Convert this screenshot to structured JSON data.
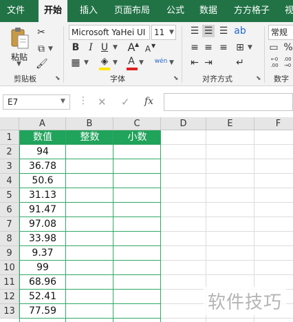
{
  "menu": {
    "tabs": [
      "文件",
      "开始",
      "插入",
      "页面布局",
      "公式",
      "数据",
      "方方格子",
      "视"
    ],
    "active": "开始"
  },
  "ribbon": {
    "clipboard": {
      "paste_label": "粘贴",
      "group_label": "剪贴板"
    },
    "font": {
      "family": "Microsoft YaHei UI",
      "size": "11",
      "bold": "B",
      "italic": "I",
      "underline": "U",
      "grow": "A",
      "shrink": "A",
      "font_color_glyph": "A",
      "phonetic": "wén",
      "group_label": "字体",
      "colors": {
        "highlight": "#ffe600",
        "font": "#e02020"
      }
    },
    "alignment": {
      "group_label": "对齐方式"
    },
    "number": {
      "format": "常规",
      "percent": "%",
      "inc_decimal": "←0 .00",
      "dec_decimal": ".00 →0",
      "group_label": "数字"
    }
  },
  "formula_bar": {
    "name_box": "E7",
    "cancel": "✕",
    "enter": "✓",
    "fx": "fx",
    "value": ""
  },
  "sheet": {
    "columns": [
      "A",
      "B",
      "C",
      "D",
      "E",
      "F"
    ],
    "rows": [
      "1",
      "2",
      "3",
      "4",
      "5",
      "6",
      "7",
      "8",
      "9",
      "10",
      "11",
      "12",
      "13"
    ],
    "header_row": [
      "数值",
      "整数",
      "小数"
    ],
    "values": [
      "94",
      "36.78",
      "50.6",
      "31.13",
      "91.47",
      "97.08",
      "33.98",
      "9.37",
      "99",
      "68.96",
      "52.41",
      "77.59"
    ]
  },
  "watermark": "软件技巧",
  "colors": {
    "brand": "#217346",
    "header_fill": "#20a35a",
    "table_border": "#2fa766"
  }
}
